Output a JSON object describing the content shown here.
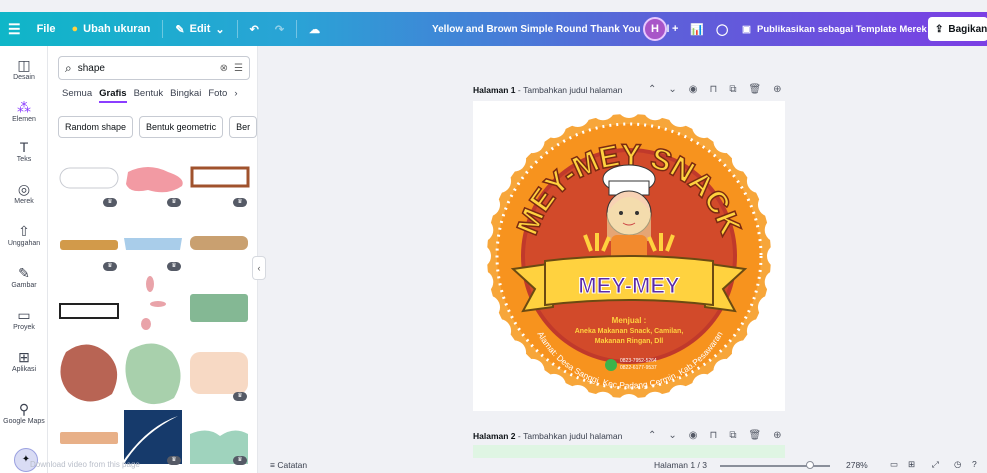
{
  "topbar": {
    "menu_icon": "hamburger-icon",
    "file": "File",
    "resize": "Ubah ukuran",
    "edit": "Edit",
    "doc_title": "Yellow and Brown Simple Round Thank You Label",
    "avatar": "H",
    "publish": "Publikasikan sebagai Template Merek",
    "share": "Bagikan"
  },
  "rail": [
    {
      "label": "Desain",
      "icon": "layout-icon"
    },
    {
      "label": "Elemen",
      "icon": "elements-icon"
    },
    {
      "label": "Teks",
      "icon": "text-icon"
    },
    {
      "label": "Merek",
      "icon": "brand-icon"
    },
    {
      "label": "Unggahan",
      "icon": "upload-icon"
    },
    {
      "label": "Gambar",
      "icon": "draw-icon"
    },
    {
      "label": "Proyek",
      "icon": "folder-icon"
    },
    {
      "label": "Aplikasi",
      "icon": "apps-icon"
    },
    {
      "label": "Google Maps",
      "icon": "map-pin-icon"
    }
  ],
  "panel": {
    "search_value": "shape",
    "tabs": [
      "Semua",
      "Grafis",
      "Bentuk",
      "Bingkai",
      "Foto"
    ],
    "active_tab": "Grafis",
    "chips": [
      "Random shape",
      "Bentuk geometric",
      "Ber"
    ]
  },
  "page1": {
    "label": "Halaman 1",
    "placeholder": "Tambahkan judul halaman"
  },
  "page2": {
    "label": "Halaman 2",
    "placeholder": "Tambahkan judul halaman"
  },
  "label_design": {
    "arc_text": "MEY-MEY SNACK",
    "banner": "MEY-MEY",
    "sell_title": "Menjual :",
    "sell_line1": "Aneka Makanan Snack, Camilan,",
    "sell_line2": "Makanan Ringan, Dll",
    "phone1": "0823-7952-5264",
    "phone2": "0822-6177-9537",
    "address": "Alamat: Desa Sanggi, Kec.Padang Cermin, Kab.Pesawaran",
    "colors": {
      "orange": "#f7931e",
      "dark": "#c0392b",
      "yellow": "#ffd23f"
    }
  },
  "bottom": {
    "notes": "Catatan",
    "page_counter": "Halaman 1 / 3",
    "zoom": "278%"
  },
  "overlay_text": "Download video from this page"
}
